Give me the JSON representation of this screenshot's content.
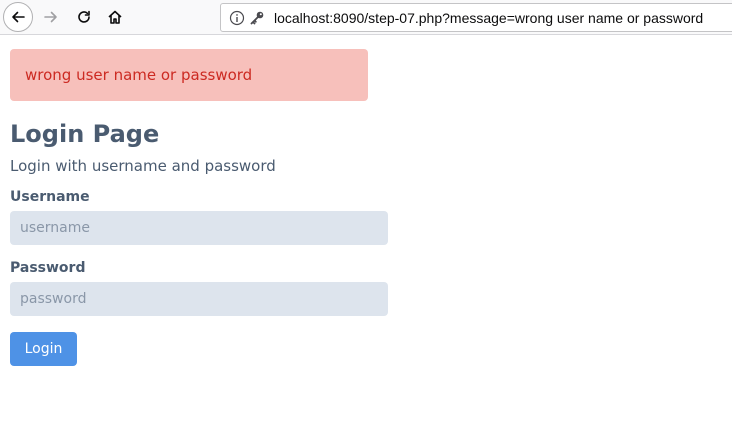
{
  "browser": {
    "url": "localhost:8090/step-07.php?message=wrong user name or password",
    "icons": {
      "back": "back-arrow-icon",
      "forward": "forward-arrow-icon",
      "reload": "reload-icon",
      "home": "home-icon",
      "info": "info-icon",
      "key": "key-icon"
    }
  },
  "alert": {
    "message": "wrong user name or password",
    "background": "#f7c0bb",
    "text_color": "#cc2a22"
  },
  "page": {
    "title": "Login Page",
    "subtitle": "Login with username and password"
  },
  "form": {
    "username_label": "Username",
    "username_placeholder": "username",
    "username_value": "",
    "password_label": "Password",
    "password_placeholder": "password",
    "password_value": "",
    "submit_label": "Login",
    "accent_color": "#4e92e6"
  }
}
